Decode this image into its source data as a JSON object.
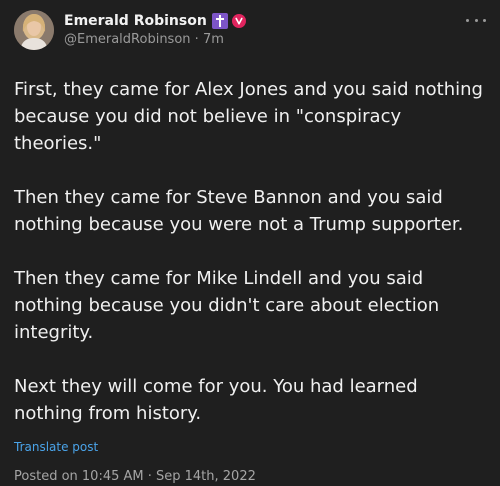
{
  "author": {
    "name": "Emerald Robinson",
    "handle": "@EmeraldRobinson",
    "separator": "·",
    "time_ago": "7m",
    "badges": [
      "cross-icon",
      "verified-icon"
    ]
  },
  "post": {
    "paragraphs": [
      "First, they came for Alex Jones and you said nothing because you did not believe in \"conspiracy theories.\"",
      "Then they came for Steve Bannon and you said nothing because you were not a Trump supporter.",
      "Then they came for Mike Lindell and you said nothing because you didn't care about election integrity.",
      "Next they will come for you. You had learned nothing from history."
    ],
    "translate_label": "Translate post",
    "posted_text": "Posted on 10:45 AM · Sep 14th, 2022"
  },
  "colors": {
    "background": "#1f1f1f",
    "link": "#4aa3e8",
    "cross_badge": "#7d55c7",
    "verified_badge": "#e0245e"
  }
}
